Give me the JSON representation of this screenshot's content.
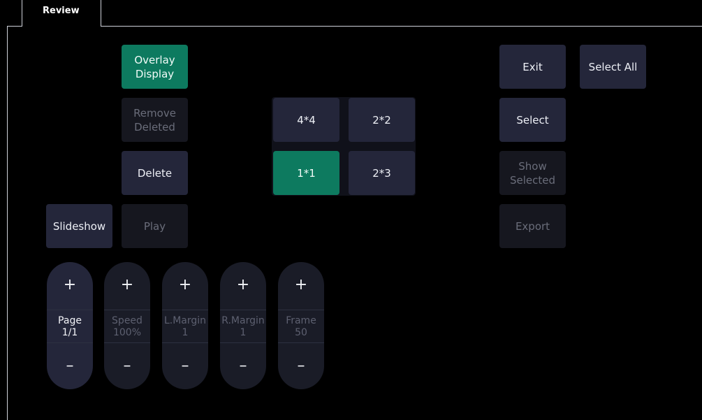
{
  "tab": {
    "label": "Review"
  },
  "buttons": {
    "overlay_display": "Overlay\nDisplay",
    "remove_deleted": "Remove\nDeleted",
    "delete": "Delete",
    "slideshow": "Slideshow",
    "play": "Play",
    "exit": "Exit",
    "select_all": "Select All",
    "select": "Select",
    "show_selected": "Show\nSelected",
    "export": "Export"
  },
  "layout_grid": {
    "options": [
      "4*4",
      "2*2",
      "1*1",
      "2*3"
    ],
    "selected": "1*1"
  },
  "steppers": [
    {
      "name": "Page",
      "value": "1/1",
      "enabled": true,
      "plus": "+",
      "minus": "–"
    },
    {
      "name": "Speed",
      "value": "100%",
      "enabled": false,
      "plus": "+",
      "minus": "–"
    },
    {
      "name": "L.Margin",
      "value": "1",
      "enabled": false,
      "plus": "+",
      "minus": "–"
    },
    {
      "name": "R.Margin",
      "value": "1",
      "enabled": false,
      "plus": "+",
      "minus": "–"
    },
    {
      "name": "Frame",
      "value": "50",
      "enabled": false,
      "plus": "+",
      "minus": "–"
    }
  ],
  "colors": {
    "accent": "#0d7a5f",
    "button": "#24263a",
    "disabled_button": "#16171f",
    "disabled_text": "#6a6d7a",
    "background": "#000000"
  }
}
